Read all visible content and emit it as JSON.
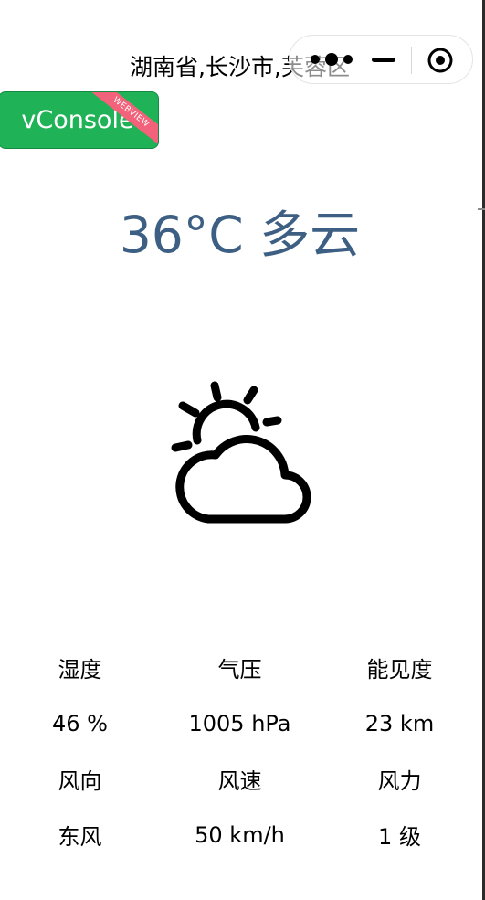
{
  "location": "湖南省,长沙市,芙蓉区",
  "capsule": {
    "more_icon": "more-dots-icon",
    "minimize_icon": "minimize-icon",
    "close_icon": "target-circle-icon"
  },
  "vconsole": {
    "label": "vConsole",
    "ribbon": "WEBVIEW",
    "bg_color": "#1fb256",
    "ribbon_color": "#f2627a"
  },
  "weather": {
    "summary": "36°C 多云",
    "icon": "partly-cloudy-icon",
    "summary_color": "#3c5f83"
  },
  "stats": {
    "labels_row1": [
      "湿度",
      "气压",
      "能见度"
    ],
    "values_row1": [
      "46 %",
      "1005 hPa",
      "23 km"
    ],
    "labels_row2": [
      "风向",
      "风速",
      "风力"
    ],
    "values_row2": [
      "东风",
      "50 km/h",
      "1 级"
    ]
  }
}
